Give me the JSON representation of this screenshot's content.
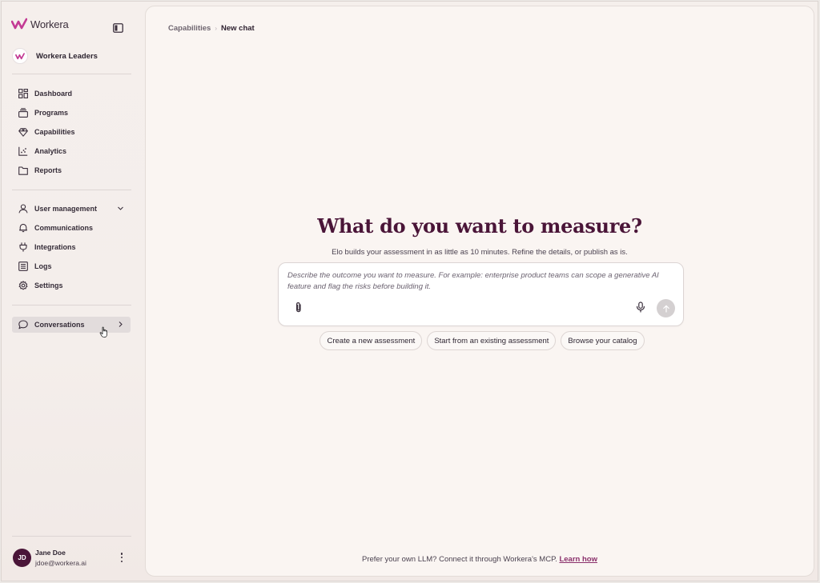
{
  "brand": {
    "name": "Workera",
    "accent": "#c33a94"
  },
  "org": {
    "name": "Workera Leaders"
  },
  "nav": {
    "primary": [
      {
        "label": "Dashboard",
        "icon": "dashboard-icon"
      },
      {
        "label": "Programs",
        "icon": "stack-icon"
      },
      {
        "label": "Capabilities",
        "icon": "gem-icon"
      },
      {
        "label": "Analytics",
        "icon": "chart-icon"
      },
      {
        "label": "Reports",
        "icon": "folder-icon"
      }
    ],
    "secondary": [
      {
        "label": "User management",
        "icon": "user-icon"
      },
      {
        "label": "Communications",
        "icon": "bell-icon"
      },
      {
        "label": "Integrations",
        "icon": "plug-icon"
      },
      {
        "label": "Logs",
        "icon": "list-icon"
      },
      {
        "label": "Settings",
        "icon": "gear-icon"
      }
    ],
    "conversations": {
      "label": "Conversations",
      "icon": "chat-icon"
    }
  },
  "user": {
    "initials": "JD",
    "name": "Jane Doe",
    "email": "jdoe@workera.ai"
  },
  "breadcrumb": {
    "parent": "Capabilities",
    "current": "New chat"
  },
  "hero": {
    "title": "What do you want to measure?",
    "subtitle": "Elo builds your assessment in as little as 10 minutes. Refine the details, or publish as is."
  },
  "composer": {
    "placeholder": "Describe the outcome you want to measure. For example: enterprise product teams can scope a generative AI feature and flag the risks before building it."
  },
  "chips": [
    "Create a new assessment",
    "Start from an existing assessment",
    "Browse your catalog"
  ],
  "footer": {
    "text": "Prefer your own LLM? Connect it through Workera's MCP.",
    "link": "Learn how"
  }
}
